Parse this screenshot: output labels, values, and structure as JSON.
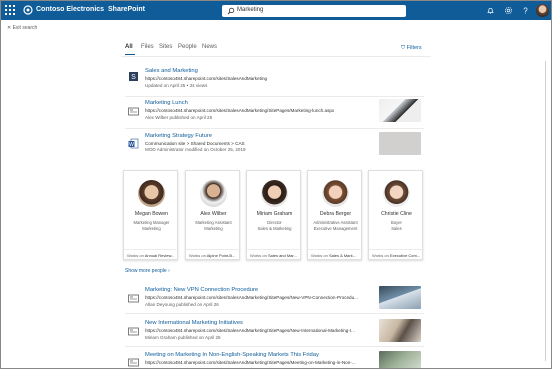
{
  "header": {
    "brand": "Contoso Electronics",
    "app": "SharePoint",
    "search_value": "Marketing"
  },
  "exit_search": "Exit search",
  "tabs": [
    {
      "label": "All",
      "active": true
    },
    {
      "label": "Files",
      "active": false
    },
    {
      "label": "Sites",
      "active": false
    },
    {
      "label": "People",
      "active": false
    },
    {
      "label": "News",
      "active": false
    }
  ],
  "filters_label": "Filters",
  "results_top": [
    {
      "title": "Sales and Marketing",
      "url": "https://contoso484.sharepoint.com/sites/SalesAndMarketing",
      "meta": "Updated on April 25 • 34 views",
      "icon": "site-icon"
    },
    {
      "title": "Marketing Lunch",
      "url": "https://contoso484.sharepoint.com/sites/SalesAndMarketing/SitePages/Marketing-lunch.aspx",
      "meta": "Alex Wilber published on April 25",
      "icon": "news-icon"
    },
    {
      "title": "Marketing Strategy Future",
      "url": "Communication site  >  Shared Documents  >  CAS",
      "meta": "MOD Administrator modified on October 25, 2019",
      "icon": "word-doc-icon"
    }
  ],
  "people": [
    {
      "name": "Megan Bowen",
      "title": "Marketing Manager",
      "dept": "Marketing",
      "foot_prefix": "Works on",
      "foot_value": "Annual Review..."
    },
    {
      "name": "Alex Wilber",
      "title": "Marketing Assistant",
      "dept": "Marketing",
      "foot_prefix": "Works on",
      "foot_value": "Alpine Point-B..."
    },
    {
      "name": "Miriam Graham",
      "title": "Director",
      "dept": "Sales & Marketing",
      "foot_prefix": "Works on",
      "foot_value": "Sales and Mar..."
    },
    {
      "name": "Debra Berger",
      "title": "Administrative Assistant",
      "dept": "Executive Management",
      "foot_prefix": "Works on",
      "foot_value": "Sales & Mark..."
    },
    {
      "name": "Christie Cline",
      "title": "Buyer",
      "dept": "Sales",
      "foot_prefix": "Works on",
      "foot_value": "Executive Com..."
    }
  ],
  "show_more_people": "Show more people",
  "results_bottom": [
    {
      "title": "Marketing: New VPN Connection Procedure",
      "url": "https://contoso484.sharepoint.com/sites/SalesAndMarketing/SitePages/New-VPN-Connection-Procedu...",
      "meta": "Allan Deyoung published on April 26",
      "icon": "news-icon"
    },
    {
      "title": "New International Marketing Initiatives",
      "url": "https://contoso484.sharepoint.com/sites/SalesAndMarketing/SitePages/New-International-Marketing-I...",
      "meta": "Miriam Graham published on April 26",
      "icon": "news-icon"
    },
    {
      "title": "Meeting on Marketing In Non-English-Speaking Markets This Friday",
      "url": "https://contoso484.sharepoint.com/sites/SalesAndMarketing/SitePages/Meeting-on-Marketing-in-Non-...",
      "meta": "",
      "icon": "news-icon"
    }
  ],
  "colors": {
    "suite_bar": "#0f5c99",
    "link": "#0f5c99"
  }
}
